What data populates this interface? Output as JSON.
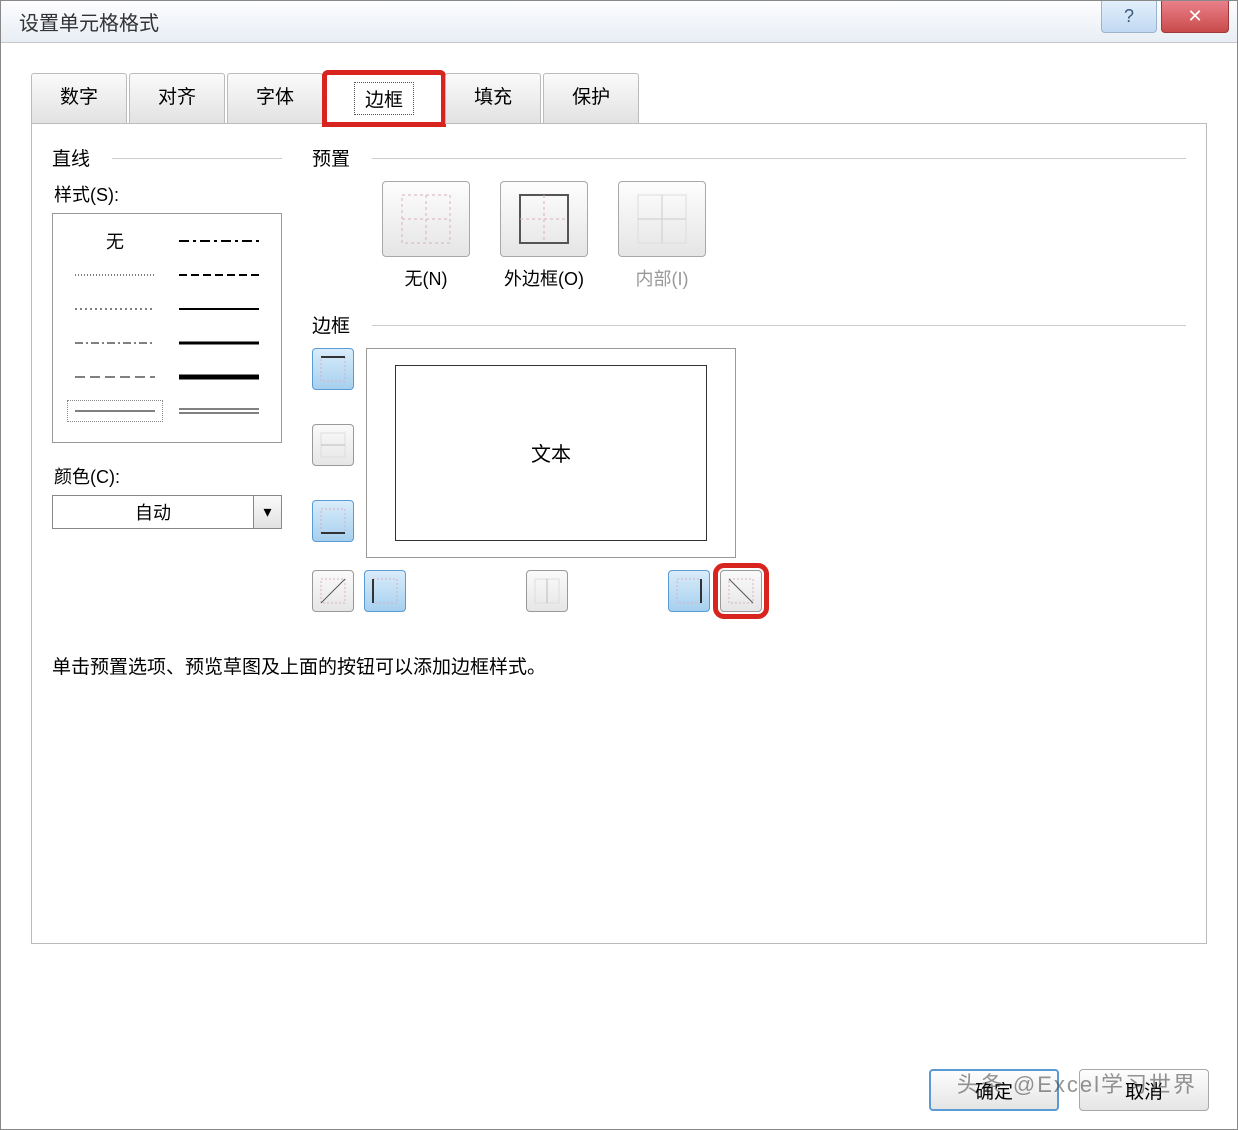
{
  "window": {
    "title": "设置单元格格式"
  },
  "tabs": {
    "number": "数字",
    "alignment": "对齐",
    "font": "字体",
    "border": "边框",
    "fill": "填充",
    "protection": "保护"
  },
  "line": {
    "header": "直线",
    "style_label": "样式(S):",
    "none_label": "无",
    "color_label": "颜色(C):",
    "color_value": "自动"
  },
  "presets": {
    "header": "预置",
    "none": "无(N)",
    "outline": "外边框(O)",
    "inside": "内部(I)"
  },
  "border_section": {
    "header": "边框",
    "preview_text": "文本"
  },
  "hint": "单击预置选项、预览草图及上面的按钮可以添加边框样式。",
  "buttons": {
    "ok": "确定",
    "cancel": "取消"
  },
  "watermark": "头条 @Excel学习世界"
}
